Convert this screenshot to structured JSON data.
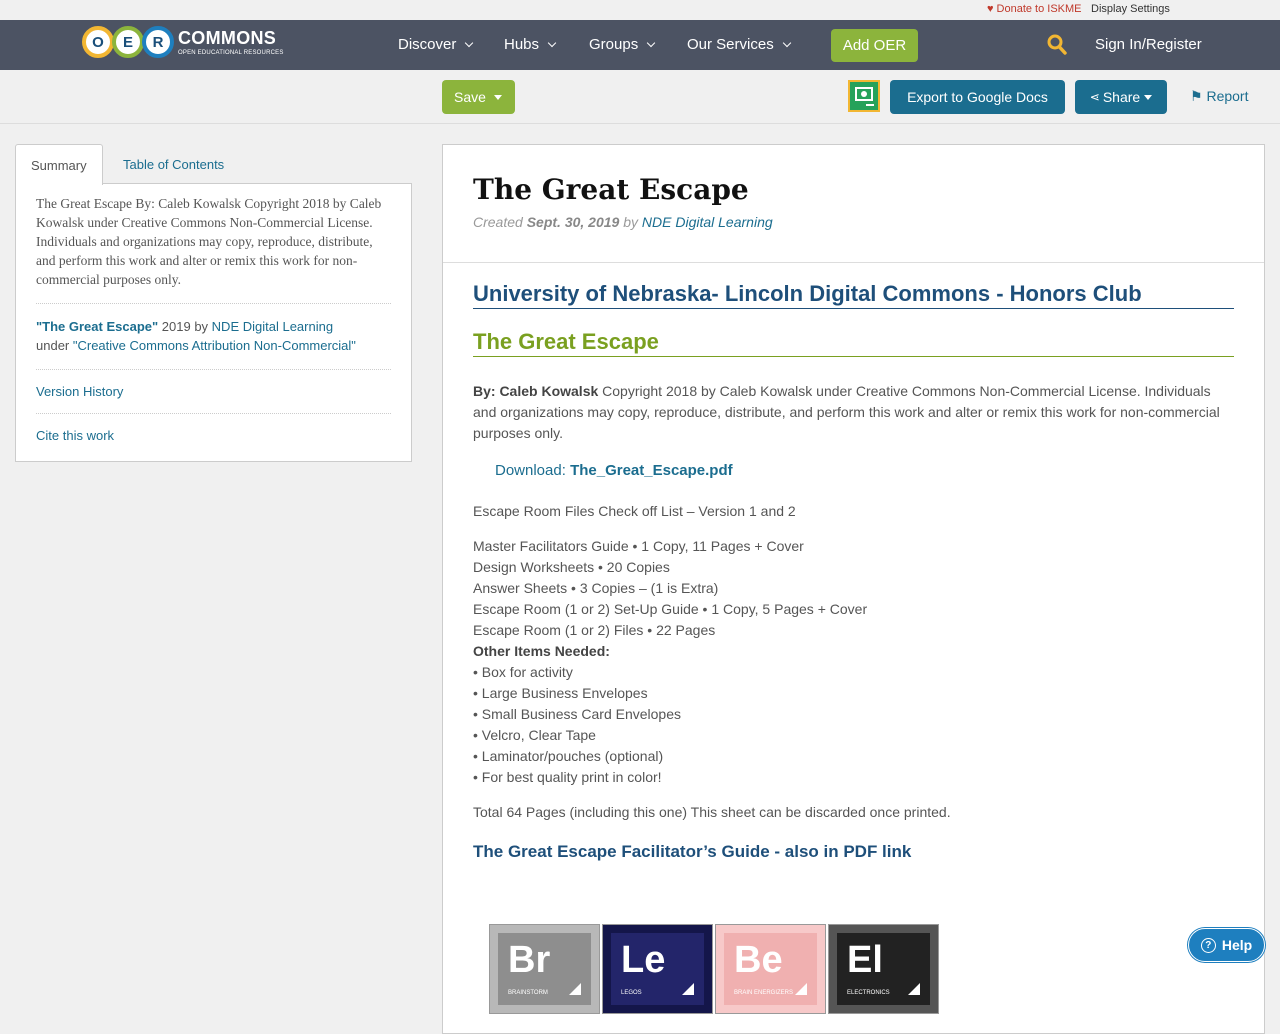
{
  "util": {
    "donate": "Donate to ISKME",
    "display_settings": "Display Settings"
  },
  "nav": {
    "logo_letters": [
      "O",
      "E",
      "R"
    ],
    "logo_commons": "COMMONS",
    "logo_sub": "OPEN EDUCATIONAL RESOURCES",
    "items": [
      "Discover",
      "Hubs",
      "Groups",
      "Our Services"
    ],
    "add_oer": "Add OER",
    "sign_in": "Sign In/Register"
  },
  "actions": {
    "save": "Save",
    "export": "Export to Google Docs",
    "share": "Share",
    "report": "Report"
  },
  "sidebar": {
    "tabs": [
      "Summary",
      "Table of Contents"
    ],
    "summary": "The Great Escape By: Caleb Kowalsk Copyright 2018 by Caleb Kowalsk under Creative Commons Non-Commercial License. Individuals and organizations may copy, reproduce, distribute, and perform this work and alter or remix this work for non-commercial purposes only.",
    "credit_title": "\"The Great Escape\"",
    "credit_year": "2019 by",
    "credit_author": "NDE Digital Learning",
    "credit_under": "under",
    "credit_license": "\"Creative Commons Attribution Non-Commercial\"",
    "version_history": "Version History",
    "cite": "Cite this work"
  },
  "content": {
    "title": "The Great Escape",
    "created_label": "Created",
    "created_date": "Sept. 30, 2019",
    "by_label": "by",
    "author": "NDE Digital Learning",
    "h_univ": "University of Nebraska- Lincoln Digital Commons - Honors Club",
    "h_escape": "The Great Escape",
    "by_bold": "By: Caleb Kowalsk",
    "by_text": " Copyright 2018 by Caleb Kowalsk under Creative Commons Non-Commercial License. Individuals and organizations may copy, reproduce, distribute, and perform this work and alter or remix this work for non-commercial purposes only.",
    "download_label": "Download:",
    "download_file": "The_Great_Escape.pdf",
    "checklist_title": "Escape Room Files Check off List – Version 1 and 2",
    "list": [
      "Master Facilitators Guide • 1 Copy, 11 Pages + Cover",
      "Design Worksheets • 20 Copies",
      "Answer Sheets • 3 Copies – (1 is Extra)",
      "Escape Room (1 or 2) Set-Up Guide • 1 Copy, 5 Pages + Cover",
      "Escape Room (1 or 2) Files • 22 Pages"
    ],
    "other_items_label": "Other Items Needed:",
    "other_items": [
      "• Box for activity",
      "• Large Business Envelopes",
      "• Small Business Card Envelopes",
      "• Velcro, Clear Tape",
      "• Laminator/pouches (optional)",
      "• For best quality print in color!"
    ],
    "total": "Total 64 Pages (including this one) This sheet can be discarded once printed.",
    "guide_link": "The Great Escape Facilitator’s Guide - also in PDF link",
    "tiles": [
      {
        "sym": "Br",
        "label": "BRAINSTORM",
        "color": "#8e8e8e"
      },
      {
        "sym": "Le",
        "label": "LEGOS",
        "color": "#23256a"
      },
      {
        "sym": "Be",
        "label": "BRAIN ENERGIZERS",
        "color": "#f0b0b0"
      },
      {
        "sym": "El",
        "label": "ELECTRONICS",
        "color": "#222222"
      }
    ]
  },
  "help": "Help",
  "colors": {
    "nav_bg": "#4c5363",
    "green": "#8cb43c",
    "teal": "#1b6d8f",
    "navy": "#1e4f7a"
  }
}
